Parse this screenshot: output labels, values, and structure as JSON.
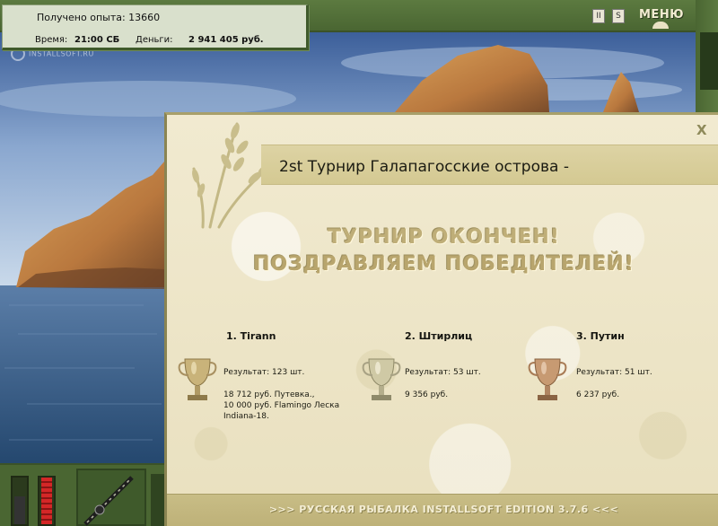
{
  "hud": {
    "experience": "Получено опыта: 13660",
    "time_label": "Время:",
    "time_value": "21:00 СБ",
    "money_label": "Деньги:",
    "money_value": "2 941 405 руб."
  },
  "watermark": "INSTALLSOFT.RU",
  "controls": {
    "pause": "II",
    "sound": "S",
    "menu": "МЕНЮ"
  },
  "gauges": {
    "left_level": 0.6,
    "right_level": 1.0
  },
  "dialog": {
    "close": "X",
    "title": "2st Турнир Галапагосские острова -",
    "headline_1": "ТУРНИР ОКОНЧЕН!",
    "headline_2": "ПОЗДРАВЛЯЕМ ПОБЕДИТЕЛЕЙ!",
    "winners": [
      {
        "name": "1. Tirann",
        "result": "Результат: 123 шт.",
        "prize_lines": [
          "18 712 руб. Путевка.,",
          "10 000 руб. Flamingo Леска",
          "Indiana-18."
        ],
        "cup": "gold"
      },
      {
        "name": "2. Штирлиц",
        "result": "Результат: 53 шт.",
        "prize_lines": [
          "9 356 руб."
        ],
        "cup": "silver"
      },
      {
        "name": "3. Путин",
        "result": "Результат: 51 шт.",
        "prize_lines": [
          "6 237 руб."
        ],
        "cup": "bronze"
      }
    ],
    "footer": ">>> РУССКАЯ РЫБАЛКА INSTALLSOFT EDITION 3.7.6 <<<"
  },
  "colors": {
    "frame_green": "#4a6632",
    "dialog_paper": "#efe7c9",
    "headline": "#bfae78",
    "cup_gold": "#c9b37a",
    "cup_silver": "#cfc9a5",
    "cup_bronze": "#c79a72"
  }
}
